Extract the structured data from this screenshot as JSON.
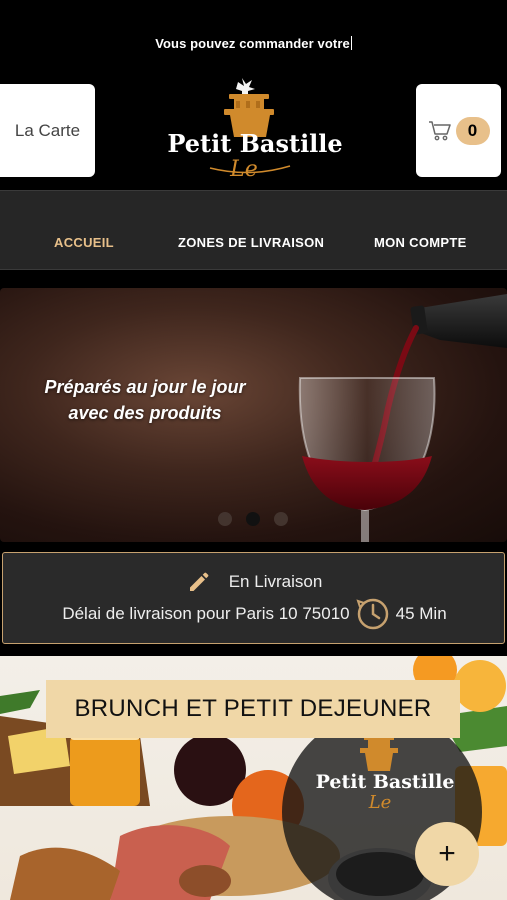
{
  "header": {
    "ticker_text": "Vous pouvez commander votre",
    "menu_button_label": "La Carte",
    "cart_count": "0",
    "logo": {
      "brand_name": "Petit Bastille",
      "script_text": "Le"
    }
  },
  "nav": {
    "items": [
      {
        "label": "ACCUEIL",
        "active": true
      },
      {
        "label": "ZONES DE LIVRAISON",
        "active": false
      },
      {
        "label": "MON COMPTE",
        "active": false
      }
    ]
  },
  "hero": {
    "line1": "Préparés au jour le jour",
    "line2": "avec des produits",
    "active_slide": 2,
    "slide_count": 3
  },
  "delivery": {
    "mode": "En Livraison",
    "info": "Délai de livraison pour Paris 10 75010",
    "time": "45 Min"
  },
  "category": {
    "title": "BRUNCH ET PETIT DEJEUNER",
    "logo_brand": "Petit Bastille",
    "logo_script": "Le",
    "add_label": "+"
  },
  "colors": {
    "accent": "#e8c08a",
    "label_bg": "#f0d7a7",
    "border_gold": "#c6a16f",
    "nav_bg": "#262626"
  }
}
